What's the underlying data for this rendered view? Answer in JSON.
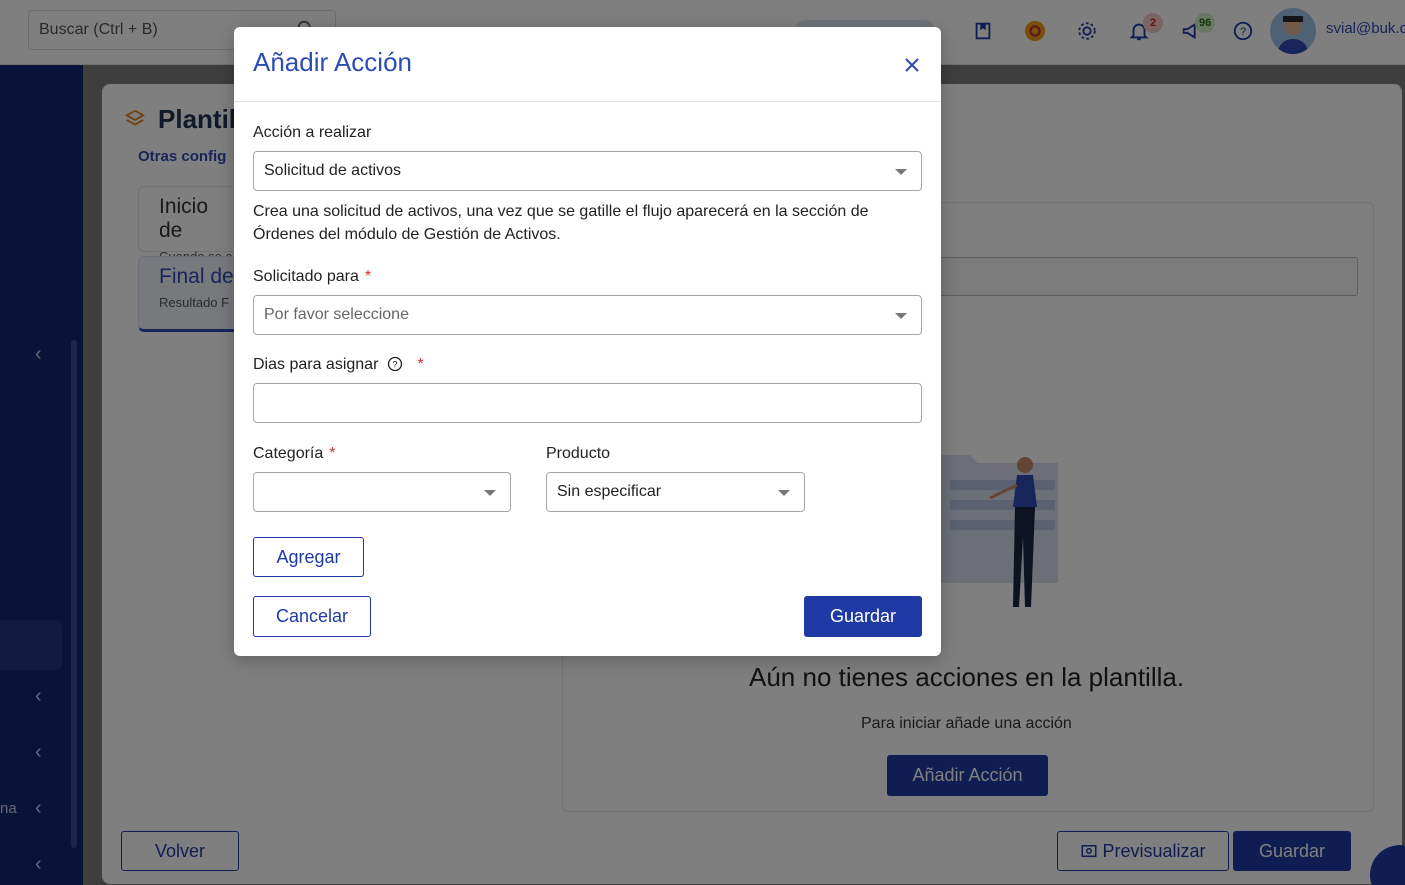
{
  "topbar": {
    "search_placeholder": "Buscar (Ctrl + B)",
    "notifications_count": "2",
    "announcements_count": "96",
    "user_email": "svial@buk.c"
  },
  "sidebar": {
    "partial_label": "na"
  },
  "background": {
    "page_title": "Plantil",
    "page_subtitle": "Otras config",
    "step_start_title": "Inicio de",
    "step_start_sub": "Cuando se c",
    "step_end_title": "Final de",
    "step_end_sub": "Resultado F",
    "empty_title": "Aún no tienes acciones en la plantilla.",
    "empty_text": "Para iniciar añade una acción",
    "add_action_label": "Añadir Acción",
    "back_label": "Volver",
    "preview_label": "Previsualizar",
    "save_label": "Guardar"
  },
  "modal": {
    "title": "Añadir Acción",
    "action_label": "Acción a realizar",
    "action_value": "Solicitud de activos",
    "description": "Crea una solicitud de activos, una vez que se gatille el flujo aparecerá en la sección de Órdenes del módulo de Gestión de Activos.",
    "requested_for_label": "Solicitado para",
    "requested_for_placeholder": "Por favor seleccione",
    "days_label": "Dias para asignar",
    "days_value": "",
    "category_label": "Categoría",
    "category_value": "",
    "product_label": "Producto",
    "product_value": "Sin especificar",
    "required_mark": "*",
    "add_label": "Agregar",
    "cancel_label": "Cancelar",
    "save_label": "Guardar"
  },
  "colors": {
    "brand_blue": "#1f3aa4",
    "title_blue": "#2f4bb5",
    "sidebar_navy": "#13276e",
    "required_red": "#d32f2f"
  },
  "icons": [
    "search-icon",
    "bookmark-icon",
    "support-icon",
    "gear-icon",
    "bell-icon",
    "megaphone-icon",
    "help-icon",
    "close-icon",
    "chevron-left-icon",
    "layers-icon",
    "eye-icon"
  ]
}
